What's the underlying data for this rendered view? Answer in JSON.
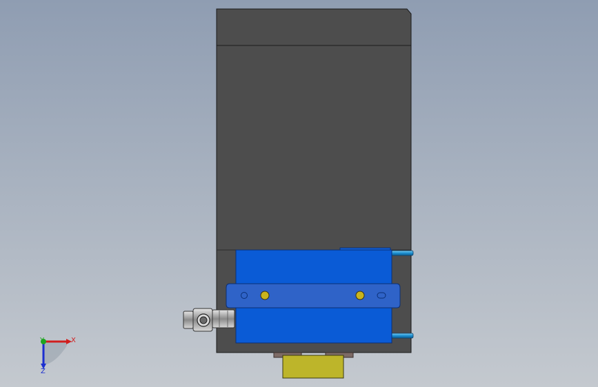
{
  "viewport": {
    "background_top": "#8f9db2",
    "background_bottom": "#c4c9cf"
  },
  "model": {
    "colors": {
      "housing": "#4d4d4d",
      "housing_cap": "#4a4a4a",
      "cylinder_body": "#0a5bd6",
      "cylinder_body_light": "#1c6ee6",
      "mounting_plate": "#3a62b8",
      "screw_head": "#c8b41e",
      "piston_rod": "#2a9fd6",
      "fitting": "#9a9a9a",
      "yellow_block": "#bdb52a",
      "brown_pad": "#7d6b66"
    }
  },
  "triad": {
    "x_label": "X",
    "y_label": "Y",
    "z_label": "Z",
    "x_color": "#d11e1e",
    "y_color": "#1fa51f",
    "z_color": "#1c2fd0"
  }
}
